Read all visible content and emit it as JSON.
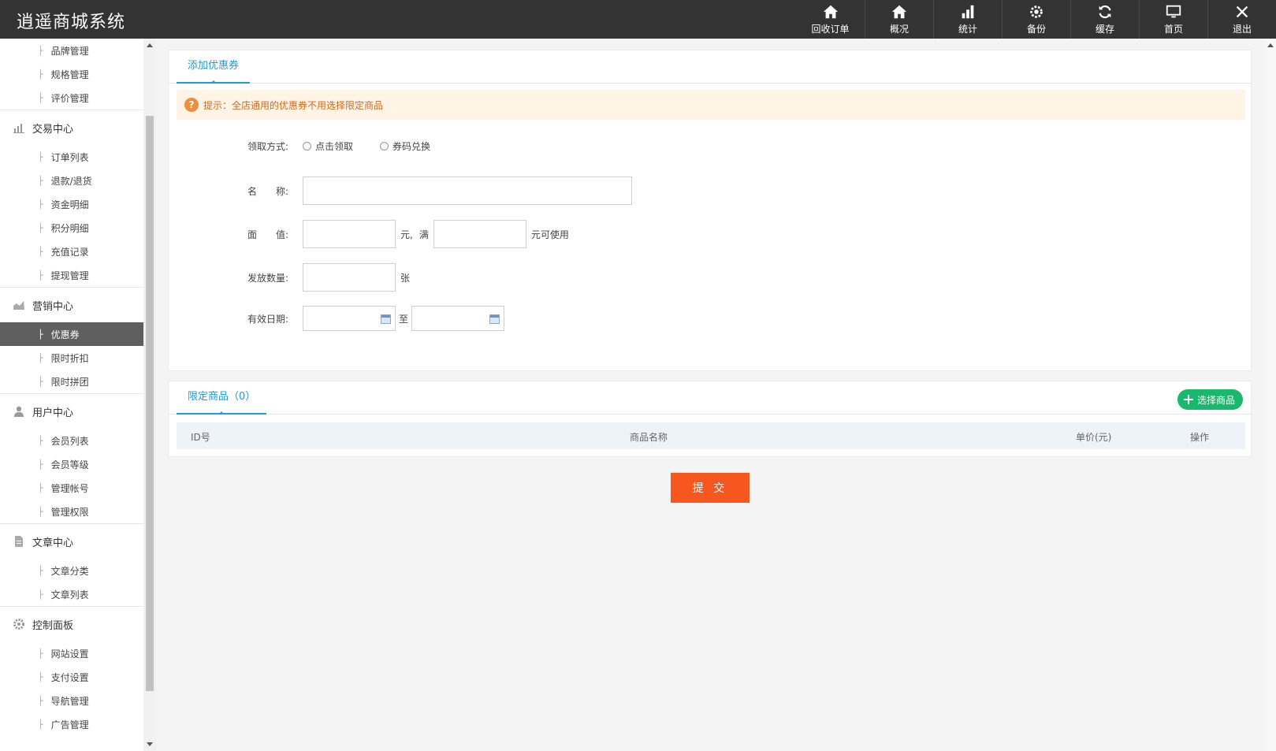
{
  "app": {
    "title": "逍遥商城系统"
  },
  "topnav": [
    {
      "label": "回收订单",
      "icon": "home-icon"
    },
    {
      "label": "概况",
      "icon": "home-icon"
    },
    {
      "label": "统计",
      "icon": "bar-chart-icon"
    },
    {
      "label": "备份",
      "icon": "gear-icon"
    },
    {
      "label": "缓存",
      "icon": "refresh-icon"
    },
    {
      "label": "首页",
      "icon": "monitor-icon"
    },
    {
      "label": "退出",
      "icon": "close-icon"
    }
  ],
  "sidebar": {
    "top_items": [
      "品牌管理",
      "规格管理",
      "评价管理"
    ],
    "groups": [
      {
        "title": "交易中心",
        "icon": "bar-chart-icon",
        "items": [
          "订单列表",
          "退款/退货",
          "资金明细",
          "积分明细",
          "充值记录",
          "提现管理"
        ]
      },
      {
        "title": "营销中心",
        "icon": "area-chart-icon",
        "items": [
          "优惠券",
          "限时折扣",
          "限时拼团"
        ]
      },
      {
        "title": "用户中心",
        "icon": "user-icon",
        "items": [
          "会员列表",
          "会员等级",
          "管理帐号",
          "管理权限"
        ]
      },
      {
        "title": "文章中心",
        "icon": "document-icon",
        "items": [
          "文章分类",
          "文章列表"
        ]
      },
      {
        "title": "控制面板",
        "icon": "gear-icon",
        "items": [
          "网站设置",
          "支付设置",
          "导航管理",
          "广告管理"
        ]
      }
    ],
    "active": "优惠券"
  },
  "form": {
    "tab": "添加优惠券",
    "tip": "提示：全店通用的优惠券不用选择限定商品",
    "receive_label": "领取方式:",
    "receive_options": [
      "点击领取",
      "券码兑换"
    ],
    "name_label": "名　　称:",
    "value_label": "面　　值:",
    "unit_yuan": "元,",
    "man": "满",
    "unit_use": "元可使用",
    "count_label": "发放数量:",
    "unit_zhang": "张",
    "date_label": "有效日期:",
    "date_to": "至"
  },
  "limited": {
    "tab": "限定商品（0）",
    "select_button": "选择商品",
    "columns": [
      "ID号",
      "商品名称",
      "单价(元)",
      "操作"
    ]
  },
  "submit_label": "提 交",
  "colors": {
    "topbar": "#333333",
    "accent": "#1f9bd7",
    "submit": "#f5571f",
    "green": "#19b86c",
    "tip_bg": "#fff4e5"
  }
}
